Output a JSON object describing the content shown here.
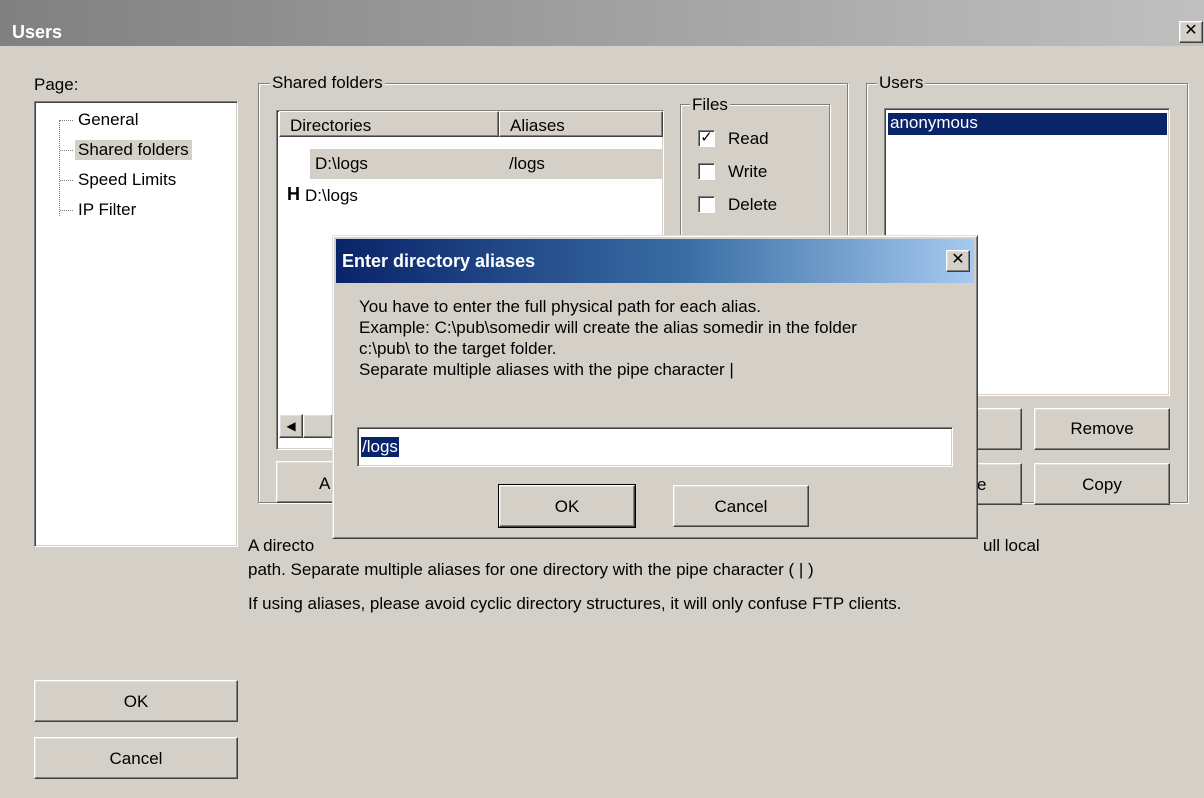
{
  "window": {
    "title": "Users",
    "close_glyph": "✕"
  },
  "page_panel": {
    "label": "Page:",
    "items": [
      "General",
      "Shared folders",
      "Speed Limits",
      "IP Filter"
    ],
    "selected_index": 1
  },
  "shared_folders": {
    "label": "Shared folders",
    "columns": [
      "Directories",
      "Aliases"
    ],
    "rows": [
      {
        "marker": "",
        "directory": "D:\\logs",
        "alias": "/logs"
      },
      {
        "marker": "H",
        "directory": "D:\\logs",
        "alias": ""
      }
    ],
    "add_button_partial": "A"
  },
  "files_group": {
    "label": "Files",
    "checkboxes": [
      {
        "label": "Read",
        "checked": true
      },
      {
        "label": "Write",
        "checked": false
      },
      {
        "label": "Delete",
        "checked": false
      }
    ]
  },
  "users_group": {
    "label": "Users",
    "users": [
      "anonymous"
    ],
    "remove_label": "Remove",
    "copy_label": "Copy",
    "partial_button": "e"
  },
  "help_text": {
    "line1_left": "A directo",
    "line1_right": "ull local",
    "line2": "path. Separate multiple aliases for one directory with the pipe character ( | )",
    "line3": "If using aliases, please avoid cyclic directory structures, it will only confuse FTP clients."
  },
  "main_buttons": {
    "ok": "OK",
    "cancel": "Cancel"
  },
  "dialog": {
    "title": "Enter directory aliases",
    "message_lines": [
      "You have to enter the full physical path for each alias.",
      "Example: C:\\pub\\somedir will create the alias somedir in the folder",
      "c:\\pub\\ to the target folder.",
      "Separate multiple aliases with the pipe character |"
    ],
    "input_value": "/logs",
    "ok_label": "OK",
    "cancel_label": "Cancel"
  },
  "colors": {
    "face": "#d4d0c8",
    "selection": "#0a246a",
    "active_title_start": "#0a246a",
    "active_title_end": "#a6caf0",
    "inactive_title": "#808080"
  }
}
